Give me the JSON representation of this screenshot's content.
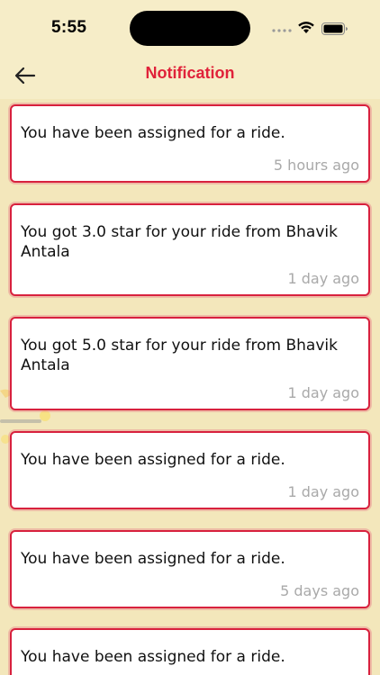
{
  "status_bar": {
    "time": "5:55",
    "signal_icon": "cellular-signal-icon",
    "wifi_icon": "wifi-icon",
    "battery_icon": "battery-icon"
  },
  "header": {
    "back_icon": "arrow-left-icon",
    "title": "Notification"
  },
  "colors": {
    "accent": "#e0223a",
    "background": "#f3e7bb",
    "card_border": "#d8213e",
    "timestamp": "#a9a9a9"
  },
  "notifications": [
    {
      "message": "You have been assigned for a ride.",
      "time": "5 hours ago"
    },
    {
      "message": "You got 3.0 star for your ride from Bhavik Antala",
      "time": "1 day ago"
    },
    {
      "message": "You got 5.0 star for your ride from Bhavik Antala",
      "time": "1 day ago"
    },
    {
      "message": "You have been assigned for a ride.",
      "time": "1 day ago"
    },
    {
      "message": "You have been assigned for a ride.",
      "time": "5 days ago"
    },
    {
      "message": "You have been assigned for a ride."
    }
  ]
}
